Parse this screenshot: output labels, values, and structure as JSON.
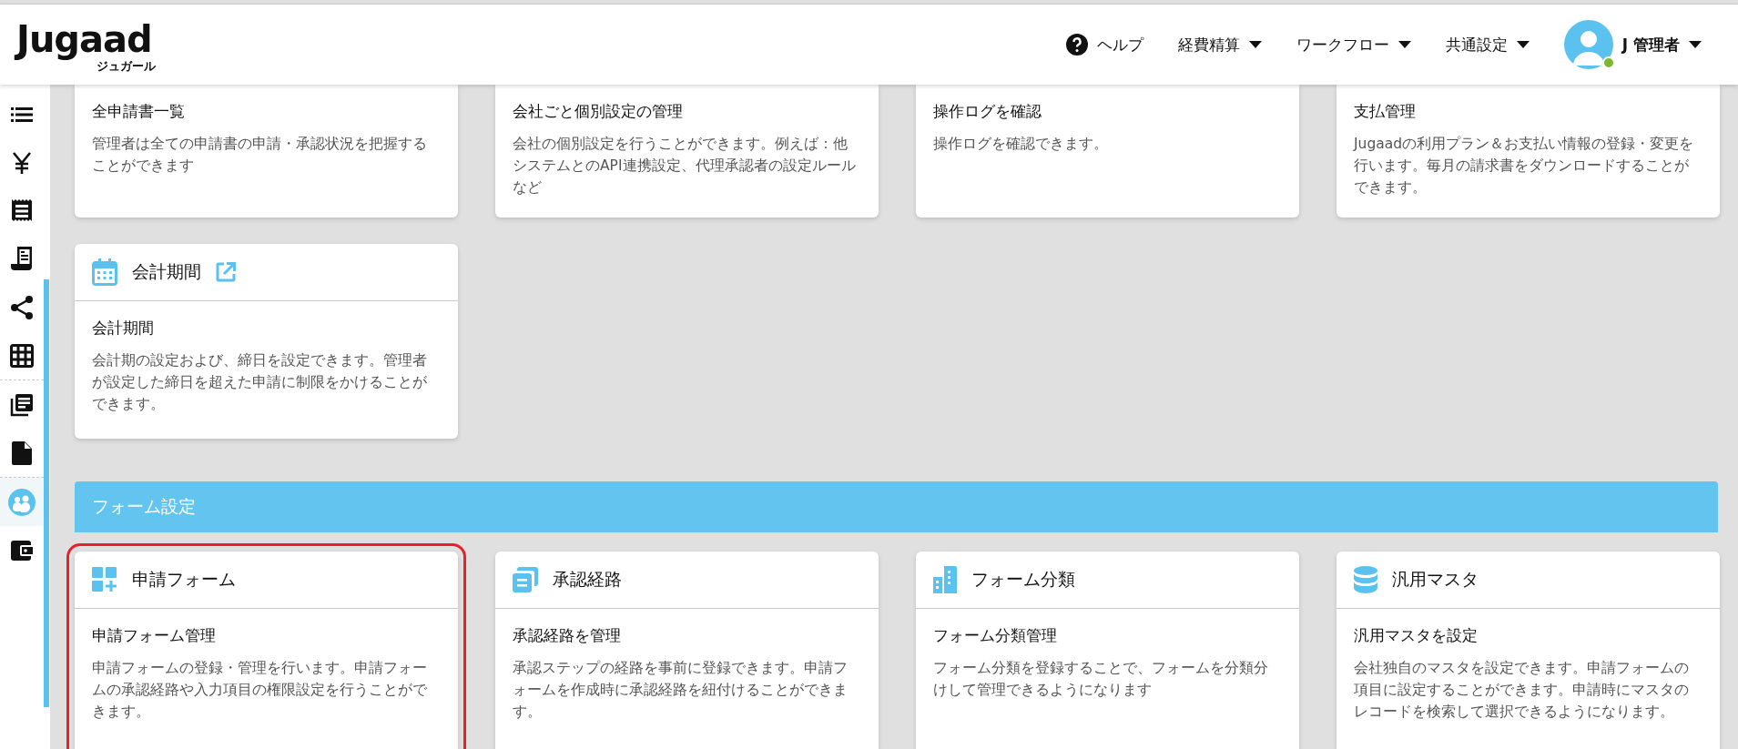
{
  "header": {
    "logo": "Jugaad",
    "logo_sub": "ジュガール",
    "nav": [
      {
        "kind": "help",
        "label": "ヘルプ"
      },
      {
        "kind": "menu",
        "label": "経費精算"
      },
      {
        "kind": "menu",
        "label": "ワークフロー"
      },
      {
        "kind": "menu",
        "label": "共通設定"
      }
    ],
    "user": {
      "name": "J 管理者",
      "online": true
    }
  },
  "sidebar": {
    "items": [
      {
        "kind": "list",
        "selected": false
      },
      {
        "kind": "yen",
        "selected": false
      },
      {
        "kind": "receipt",
        "selected": false
      },
      {
        "kind": "slip",
        "selected": false
      },
      {
        "kind": "share",
        "selected": false
      },
      {
        "kind": "grid",
        "selected": false
      },
      {
        "kind": "library",
        "selected": false
      },
      {
        "kind": "file",
        "selected": false
      },
      {
        "kind": "people",
        "selected": true
      },
      {
        "kind": "wallet",
        "selected": false
      }
    ]
  },
  "cards": [
    {
      "title": "全申請書一覧",
      "description": "管理者は全ての申請書の申請・承認状況を把握することができます"
    },
    {
      "title": "会社ごと個別設定の管理",
      "description": "会社の個別設定を行うことができます。例えば：他システムとのAPI連携設定、代理承認者の設定ルールなど"
    },
    {
      "title": "操作ログを確認",
      "description": "操作ログを確認できます。"
    },
    {
      "title": "支払管理",
      "description": "Jugaadの利用プラン＆お支払い情報の登録・変更を行います。毎月の請求書をダウンロードすることができます。"
    },
    {
      "kind": "calendar",
      "heading": "会計期間",
      "external_link": true,
      "title": "会計期間",
      "description": "会計期の設定および、締日を設定できます。管理者が設定した締日を超えた申請に制限をかけることができます。"
    }
  ],
  "section": {
    "title": "フォーム設定",
    "cards": [
      {
        "kind": "form",
        "heading": "申請フォーム",
        "title": "申請フォーム管理",
        "description": "申請フォームの登録・管理を行います。申請フォームの承認経路や入力項目の権限設定を行うことができます。",
        "highlighted": true
      },
      {
        "kind": "route",
        "heading": "承認経路",
        "title": "承認経路を管理",
        "description": "承認ステップの経路を事前に登録できます。申請フォームを作成時に承認経路を紐付けることができます。",
        "highlighted": false
      },
      {
        "kind": "building",
        "heading": "フォーム分類",
        "title": "フォーム分類管理",
        "description": "フォーム分類を登録することで、フォームを分類分けして管理できるようになります",
        "highlighted": false
      },
      {
        "kind": "database",
        "heading": "汎用マスタ",
        "title": "汎用マスタを設定",
        "description": "会社独自のマスタを設定できます。申請フォームの項目に設定することができます。申請時にマスタのレコードを検索して選択できるようになります。",
        "highlighted": false
      }
    ]
  }
}
